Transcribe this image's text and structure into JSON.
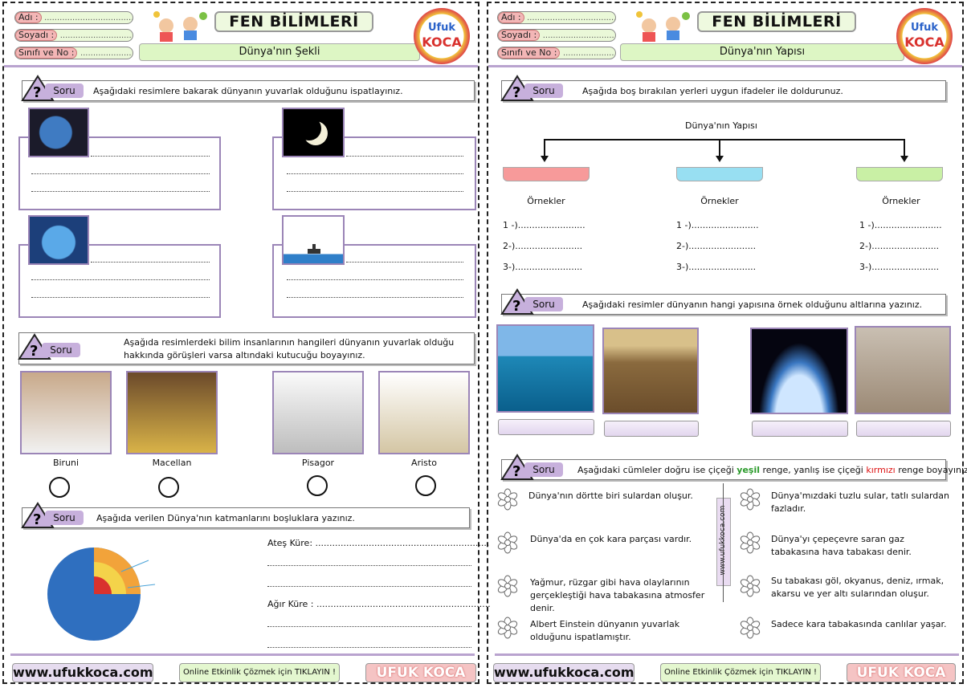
{
  "left": {
    "header": {
      "adi_label": "Adı :",
      "soyadi_label": "Soyadı :",
      "sinifi_label": "Sınıfı ve No :",
      "dots": "........................................",
      "title": "FEN BİLİMLERİ",
      "subtitle": "Dünya'nın Şekli",
      "logo_top": "Ufuk",
      "logo_bottom": "KOCA"
    },
    "q1": {
      "tag": "Soru",
      "text": "Aşağıdaki resimlere bakarak dünyanın yuvarlak olduğunu ispatlayınız."
    },
    "q2": {
      "tag": "Soru",
      "line1": "Aşağıda resimlerdeki bilim insanlarının hangileri dünyanın yuvarlak olduğu",
      "line2": "hakkında görüşleri varsa altındaki kutucuğu boyayınız."
    },
    "scientists": [
      "Biruni",
      "Macellan",
      "Pisagor",
      "Aristo"
    ],
    "q3": {
      "tag": "Soru",
      "text": "Aşağıda verilen Dünya'nın katmanlarını boşluklara yazınız."
    },
    "layers": {
      "ates": "Ateş Küre: ..............................................................",
      "agir": "Ağır Küre : .............................................................."
    },
    "footer": {
      "site": "www.ufukkoca.com",
      "online": "Online Etkinlik Çözmek için TIKLAYIN !",
      "brand": "UFUK KOCA"
    }
  },
  "right": {
    "header": {
      "adi_label": "Adı :",
      "soyadi_label": "Soyadı :",
      "sinifi_label": "Sınıfı ve No :",
      "dots": "........................................",
      "title": "FEN BİLİMLERİ",
      "subtitle": "Dünya'nın Yapısı",
      "logo_top": "Ufuk",
      "logo_bottom": "KOCA"
    },
    "q1": {
      "tag": "Soru",
      "text": "Aşağıda boş bırakılan yerleri uygun ifadeler ile doldurunuz."
    },
    "tree": {
      "root": "Dünya'nın Yapısı",
      "examples": "Örnekler",
      "lines": [
        "1 -)........................",
        "2-)........................",
        "3-)........................"
      ],
      "colors": [
        "#f79a9a",
        "#98dff2",
        "#c9f0a5"
      ]
    },
    "q2": {
      "tag": "Soru",
      "text": "Aşağıdaki resimler dünyanın hangi yapısına örnek olduğunu altlarına yazınız."
    },
    "q3": {
      "tag": "Soru",
      "pre": "Aşağıdaki cümleler doğru ise çiçeği ",
      "green": "yeşil",
      "mid": " renge, yanlış ise çiçeği ",
      "red": "kırmızı",
      "post": " renge boyayınız."
    },
    "statements_left": [
      "Dünya'nın dörtte biri sulardan oluşur.",
      "Dünya'da en çok kara parçası vardır.",
      "Yağmur, rüzgar gibi hava olaylarının gerçekleştiği hava tabakasına atmosfer denir.",
      "Albert Einstein dünyanın yuvarlak olduğunu ispatlamıştır."
    ],
    "statements_right": [
      "Dünya'mızdaki tuzlu sular, tatlı sulardan fazladır.",
      "Dünya'yı çepeçevre saran gaz tabakasına hava tabakası denir.",
      "Su tabakası göl, okyanus, deniz, ırmak, akarsu ve yer altı sularından oluşur.",
      "Sadece kara tabakasında canlılar yaşar."
    ],
    "vertical": "www.ufukkoca.com",
    "footer": {
      "site": "www.ufukkoca.com",
      "online": "Online Etkinlik Çözmek için TIKLAYIN !",
      "brand": "UFUK KOCA"
    }
  }
}
